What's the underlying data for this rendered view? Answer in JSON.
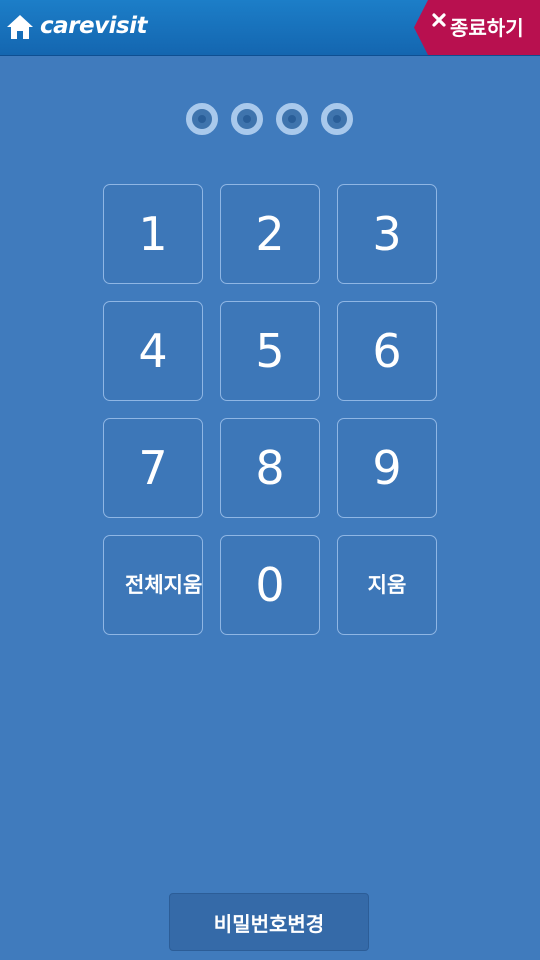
{
  "header": {
    "brand": "carevisit",
    "home_icon": "home-icon",
    "exit_icon": "close-icon",
    "exit_label": "종료하기",
    "colors": {
      "bar": "#1466b0",
      "exit": "#b8104f"
    }
  },
  "pin": {
    "length": 4,
    "entered": 0
  },
  "keypad": {
    "keys": [
      "1",
      "2",
      "3",
      "4",
      "5",
      "6",
      "7",
      "8",
      "9",
      "전체지움",
      "0",
      "지움"
    ]
  },
  "footer": {
    "change_password_label": "비밀번호변경"
  },
  "colors": {
    "background": "#407bbd",
    "key_border": "#8fb6e4",
    "pin_dot": "#a9c9ec"
  }
}
